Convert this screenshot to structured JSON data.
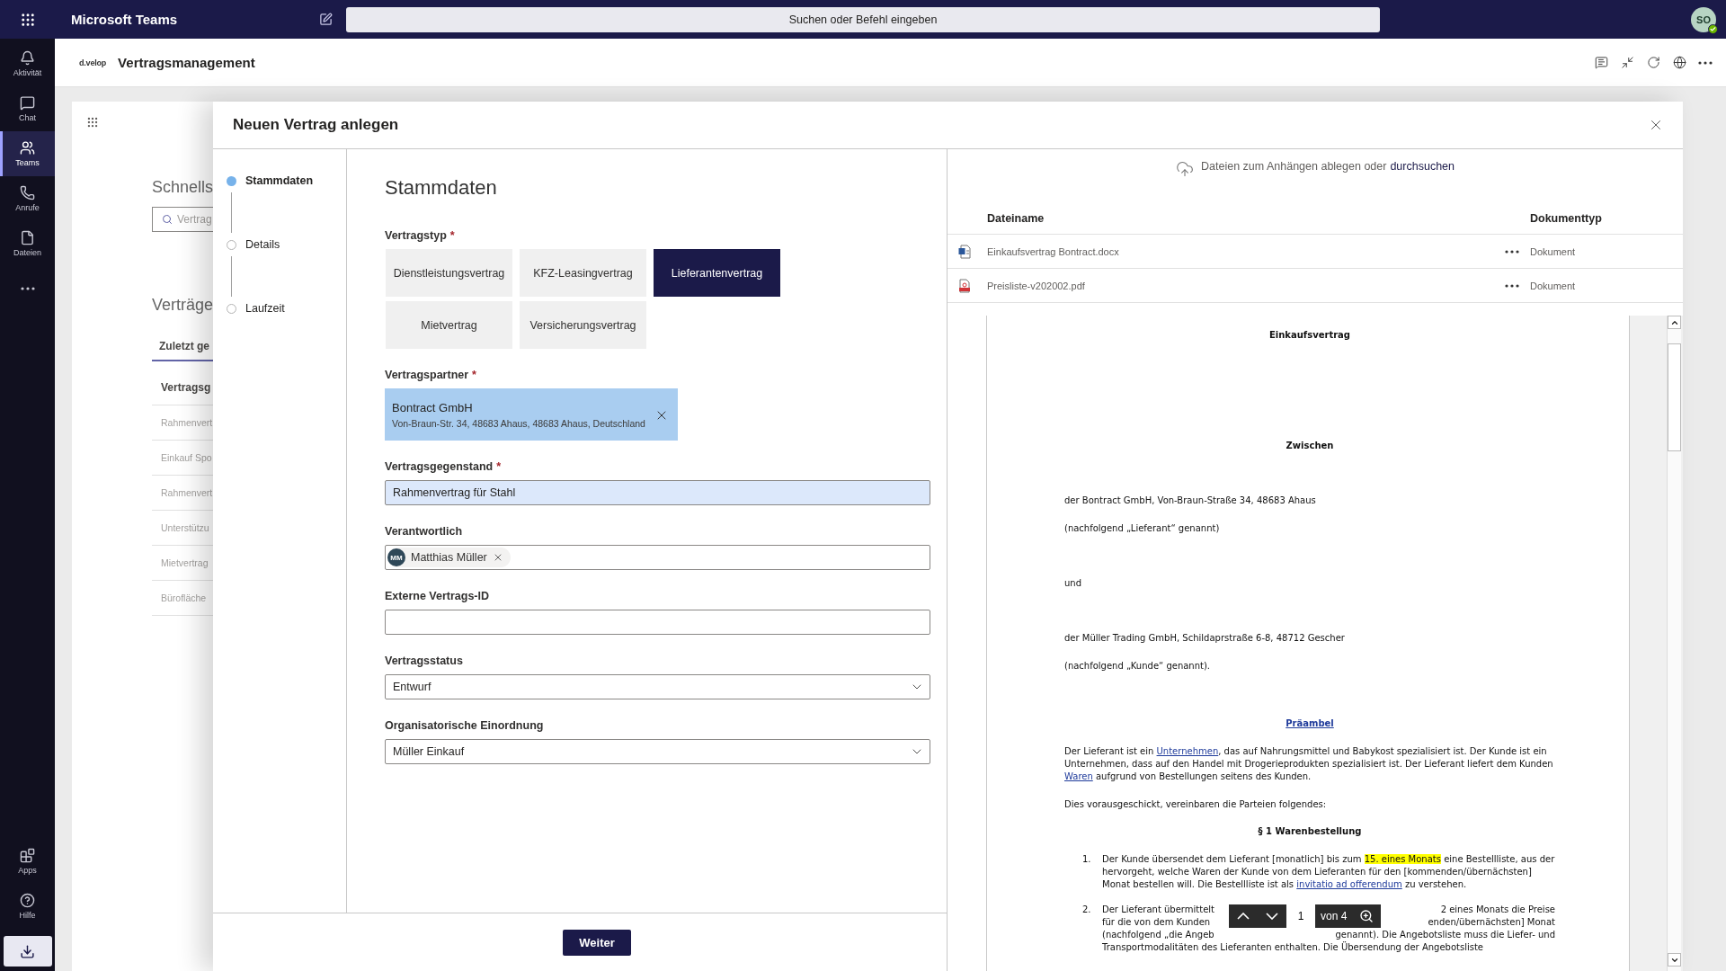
{
  "top_bar": {
    "app_title": "Microsoft Teams",
    "search_placeholder": "Suchen oder Befehl eingeben",
    "avatar_initials": "SO"
  },
  "rail": {
    "items": [
      {
        "label": "Aktivität",
        "kind": "bell",
        "selected": false
      },
      {
        "label": "Chat",
        "kind": "chat",
        "selected": false
      },
      {
        "label": "Teams",
        "kind": "teams",
        "selected": true
      },
      {
        "label": "Anrufe",
        "kind": "phone",
        "selected": false
      },
      {
        "label": "Dateien",
        "kind": "file",
        "selected": false
      },
      {
        "kind": "more",
        "selected": false
      }
    ],
    "bottom_items": [
      {
        "label": "Apps",
        "kind": "apps"
      },
      {
        "label": "Hilfe",
        "kind": "help"
      }
    ]
  },
  "app_header": {
    "logo": "d.velop",
    "title": "Vertragsmanagement"
  },
  "background": {
    "heading": "Schnells",
    "search_placeholder": "Vertrag",
    "section_title": "Verträge",
    "tab": "Zuletzt ge",
    "column": "Vertragsg",
    "rows": [
      "Rahmenvert",
      "Einkauf Spo",
      "Rahmenvert",
      "Unterstützu",
      "Mietvertrag",
      "Bürofläche"
    ]
  },
  "dialog": {
    "title": "Neuen Vertrag anlegen",
    "steps": [
      {
        "label": "Stammdaten",
        "selected": true
      },
      {
        "label": "Details",
        "selected": false
      },
      {
        "label": "Laufzeit",
        "selected": false
      }
    ],
    "form": {
      "heading": "Stammdaten",
      "fields": [
        {
          "kind": "choice",
          "label": "Vertragstyp",
          "required_mark": "*",
          "options": [
            {
              "label": "Dienstleistungsvertrag",
              "selected": false
            },
            {
              "label": "KFZ-Leasingvertrag",
              "selected": false
            },
            {
              "label": "Lieferantenvertrag",
              "selected": true
            },
            {
              "label": "Mietvertrag",
              "selected": false
            },
            {
              "label": "Versicherungsvertrag",
              "selected": false
            }
          ]
        },
        {
          "kind": "partner",
          "label": "Vertragspartner",
          "required_mark": "*",
          "name": "Bontract GmbH",
          "address": "Von-Braun-Str. 34, 48683 Ahaus, 48683 Ahaus, Deutschland"
        },
        {
          "kind": "text",
          "label": "Vertragsgegenstand",
          "required_mark": "*",
          "value": "Rahmenvertrag für Stahl",
          "focused": true
        },
        {
          "kind": "people",
          "label": "Verantwortlich",
          "initials": "MM",
          "name": "Matthias Müller"
        },
        {
          "kind": "text",
          "label": "Externe Vertrags-ID",
          "focused": false
        },
        {
          "kind": "select",
          "label": "Vertragsstatus",
          "value": "Entwurf"
        },
        {
          "kind": "select",
          "label": "Organisatorische Einordnung",
          "value": "Müller Einkauf"
        }
      ]
    },
    "next_button": "Weiter"
  },
  "attachments": {
    "drop_text": "Dateien zum Anhängen ablegen oder",
    "browse_link": "durchsuchen",
    "columns": [
      "Dateiname",
      "Dokumenttyp"
    ],
    "files": [
      {
        "name": "Einkaufsvertrag Bontract.docx",
        "kind": "word",
        "type": "Dokument"
      },
      {
        "name": "Preisliste-v202002.pdf",
        "kind": "pdf",
        "type": "Dokument"
      }
    ]
  },
  "preview": {
    "page_input": "1",
    "page_total": "von 4",
    "blocks": [
      {
        "kind": "title",
        "segments": [
          {
            "text": "Einkaufsvertrag"
          }
        ]
      },
      {
        "kind": "title",
        "segments": [
          {
            "text": "Zwischen"
          }
        ]
      },
      {
        "kind": "para",
        "segments": [
          {
            "text": "der Bontract GmbH, Von-Braun-Straße 34, 48683 Ahaus"
          }
        ]
      },
      {
        "kind": "para",
        "segments": [
          {
            "text": "(nachfolgend „Lieferant“ genannt)"
          }
        ]
      },
      {
        "kind": "para",
        "segments": [
          {
            "text": "und"
          }
        ]
      },
      {
        "kind": "para",
        "segments": [
          {
            "text": "der Müller Trading GmbH, Schildaprstraße 6-8, 48712 Gescher"
          }
        ]
      },
      {
        "kind": "para",
        "segments": [
          {
            "text": "(nachfolgend „Kunde“ genannt)."
          }
        ]
      },
      {
        "kind": "link_heading",
        "segments": [
          {
            "text": "Präambel"
          }
        ]
      },
      {
        "kind": "para",
        "segments": [
          {
            "text": "Der Lieferant ist ein "
          },
          {
            "kind": "link",
            "text": "Unternehmen"
          },
          {
            "text": ", das auf Nahrungsmittel und Babykost spezialisiert ist. Der Kunde ist ein Unternehmen, dass auf den Handel mit Drogerieprodukten spezialisiert ist. Der Lieferant liefert dem Kunden "
          },
          {
            "kind": "link",
            "text": "Waren"
          },
          {
            "text": " aufgrund von Bestellungen seitens des Kunden."
          }
        ]
      },
      {
        "kind": "para",
        "segments": [
          {
            "text": "Dies vorausgeschickt, vereinbaren die Parteien folgendes:"
          }
        ]
      },
      {
        "kind": "title",
        "segments": [
          {
            "text": "§ 1 Warenbestellung"
          }
        ]
      },
      {
        "kind": "item",
        "number": "1.",
        "segments": [
          {
            "text": "Der Kunde übersendet dem Lieferant [monatlich] bis zum "
          },
          {
            "kind": "highlight",
            "text": "15. eines Monats"
          },
          {
            "text": " eine Bestellliste, aus der hervorgeht, welche Waren der Kunde von dem Lieferanten für den [kommenden/übernächsten] Monat bestellen will. Die Bestellliste ist als "
          },
          {
            "kind": "link",
            "text": "invitatio ad offerendum"
          },
          {
            "text": " zu verstehen."
          }
        ]
      },
      {
        "kind": "item_lines",
        "number": "2.",
        "lines": [
          [
            "Der Lieferant übermittelt",
            "2 eines Monats die Preise"
          ],
          [
            "für die von dem Kunden",
            "enden/übernächsten] Monat"
          ],
          [
            "(nachfolgend „die Angeb",
            "genannt). Die Angebotsliste muss die Liefer- und"
          ],
          [
            "Transportmodalitäten des Lieferanten enthalten. Die Übersendung der Angebotsliste"
          ]
        ]
      }
    ]
  }
}
